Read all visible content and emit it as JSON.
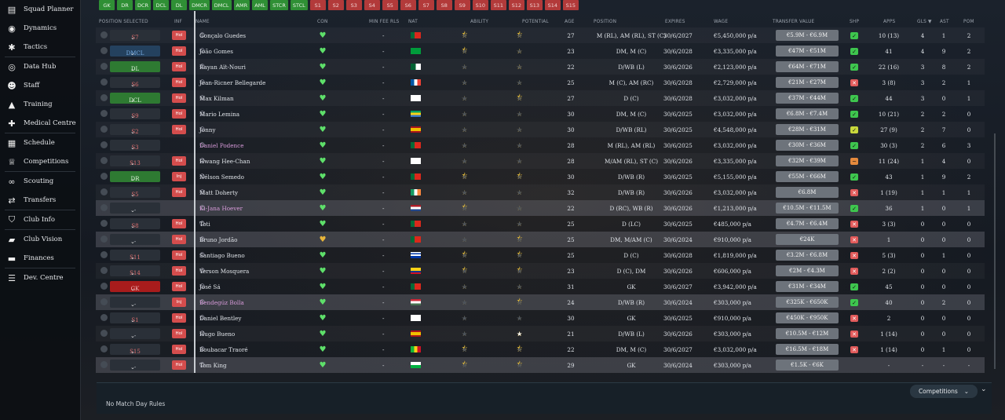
{
  "sidebar": {
    "items": [
      {
        "label": "Squad Planner",
        "icon": "clipboard-icon",
        "glyph": "▤"
      },
      {
        "label": "Dynamics",
        "icon": "dynamics-icon",
        "glyph": "◉"
      },
      {
        "label": "Tactics",
        "icon": "tactics-icon",
        "glyph": "✱"
      },
      {
        "label": "Data Hub",
        "icon": "data-hub-icon",
        "glyph": "◎"
      },
      {
        "label": "Staff",
        "icon": "staff-icon",
        "glyph": "☻"
      },
      {
        "label": "Training",
        "icon": "training-icon",
        "glyph": "▲"
      },
      {
        "label": "Medical Centre",
        "icon": "medical-icon",
        "glyph": "✚"
      },
      {
        "label": "Schedule",
        "icon": "calendar-icon",
        "glyph": "▦"
      },
      {
        "label": "Competitions",
        "icon": "trophy-icon",
        "glyph": "♕"
      },
      {
        "label": "Scouting",
        "icon": "binoculars-icon",
        "glyph": "∞"
      },
      {
        "label": "Transfers",
        "icon": "transfers-icon",
        "glyph": "⇄"
      },
      {
        "label": "Club Info",
        "icon": "club-info-icon",
        "glyph": "⛉"
      },
      {
        "label": "Club Vision",
        "icon": "club-vision-icon",
        "glyph": "▰"
      },
      {
        "label": "Finances",
        "icon": "finances-icon",
        "glyph": "▬"
      },
      {
        "label": "Dev. Centre",
        "icon": "dev-centre-icon",
        "glyph": "☰"
      }
    ]
  },
  "position_filters": [
    {
      "label": "GK",
      "state": "filled"
    },
    {
      "label": "DR",
      "state": "filled"
    },
    {
      "label": "DCR",
      "state": "filled"
    },
    {
      "label": "DCL",
      "state": "filled"
    },
    {
      "label": "DL",
      "state": "filled"
    },
    {
      "label": "DMCR",
      "state": "filled"
    },
    {
      "label": "DMCL",
      "state": "filled"
    },
    {
      "label": "AMR",
      "state": "filled"
    },
    {
      "label": "AML",
      "state": "filled"
    },
    {
      "label": "STCR",
      "state": "filled"
    },
    {
      "label": "STCL",
      "state": "filled"
    },
    {
      "label": "S1",
      "state": "sub"
    },
    {
      "label": "S2",
      "state": "sub"
    },
    {
      "label": "S3",
      "state": "sub"
    },
    {
      "label": "S4",
      "state": "sub"
    },
    {
      "label": "S5",
      "state": "sub"
    },
    {
      "label": "S6",
      "state": "sub"
    },
    {
      "label": "S7",
      "state": "sub"
    },
    {
      "label": "S8",
      "state": "sub"
    },
    {
      "label": "S9",
      "state": "sub"
    },
    {
      "label": "S10",
      "state": "sub"
    },
    {
      "label": "S11",
      "state": "sub"
    },
    {
      "label": "S12",
      "state": "sub"
    },
    {
      "label": "S13",
      "state": "sub"
    },
    {
      "label": "S14",
      "state": "sub"
    },
    {
      "label": "S15",
      "state": "sub"
    }
  ],
  "columns": {
    "position_selected": "POSITION SELECTED",
    "inf": "INF",
    "name": "NAME",
    "con": "CON",
    "min_fee": "MIN FEE RLS",
    "nat": "NAT",
    "ability": "ABILITY",
    "potential": "POTENTIAL",
    "age": "AGE",
    "position": "POSITION",
    "expires": "EXPIRES",
    "wage": "WAGE",
    "transfer_value": "TRANSFER VALUE",
    "shp": "SHP",
    "apps": "APPS",
    "gls": "GLS",
    "sort_indicator": "▼",
    "ast": "AST",
    "pom": "POM"
  },
  "players": [
    {
      "sel": "S7",
      "selc": "red",
      "inf": "Hol",
      "name": "Gonçalo Guedes",
      "pink": false,
      "con": "g",
      "minfee": "-",
      "nat": "POR",
      "ab": 3.5,
      "pot": 3.5,
      "age": "27",
      "pos": "M (RL), AM (RL), ST (C)",
      "exp": "30/6/2027",
      "wage": "€5,450,000 p/a",
      "tv": "€5.9M - €6.9M",
      "shp": "g",
      "apps": "10 (13)",
      "gls": "4",
      "ast": "1",
      "pom": "2",
      "bg": "alt"
    },
    {
      "sel": "DMCL",
      "selc": "blue",
      "inf": "Hol",
      "name": "João Gomes",
      "pink": false,
      "con": "g",
      "minfee": "-",
      "nat": "BRA",
      "ab": 3.5,
      "pot": 4,
      "age": "23",
      "pos": "DM, M (C)",
      "exp": "30/6/2028",
      "wage": "€3,335,000 p/a",
      "tv": "€47M - €51M",
      "shp": "g",
      "apps": "41",
      "gls": "4",
      "ast": "9",
      "pom": "2",
      "bg": ""
    },
    {
      "sel": "DL",
      "selc": "green",
      "inf": "Hol",
      "name": "Rayan Aït-Nouri",
      "pink": false,
      "con": "g",
      "minfee": "-",
      "nat": "ALG",
      "ab": 3,
      "pot": 4,
      "age": "22",
      "pos": "D/WB (L)",
      "exp": "30/6/2026",
      "wage": "€2,123,000 p/a",
      "tv": "€64M - €71M",
      "shp": "g",
      "apps": "22 (16)",
      "gls": "3",
      "ast": "8",
      "pom": "2",
      "bg": "alt"
    },
    {
      "sel": "S6",
      "selc": "red",
      "inf": "Hol",
      "name": "Jean-Ricner Bellegarde",
      "pink": false,
      "con": "g",
      "minfee": "-",
      "nat": "FRA",
      "ab": 3,
      "pot": 3,
      "age": "25",
      "pos": "M (C), AM (RC)",
      "exp": "30/6/2028",
      "wage": "€2,729,000 p/a",
      "tv": "€21M - €27M",
      "shp": "r",
      "apps": "3 (8)",
      "gls": "3",
      "ast": "2",
      "pom": "1",
      "bg": ""
    },
    {
      "sel": "DCL",
      "selc": "green",
      "inf": "Hol",
      "name": "Max Kilman",
      "pink": false,
      "con": "g",
      "minfee": "-",
      "nat": "ENG",
      "ab": 3,
      "pot": 3.5,
      "age": "27",
      "pos": "D (C)",
      "exp": "30/6/2028",
      "wage": "€3,032,000 p/a",
      "tv": "€37M - €44M",
      "shp": "g",
      "apps": "44",
      "gls": "3",
      "ast": "0",
      "pom": "1",
      "bg": "alt"
    },
    {
      "sel": "S9",
      "selc": "red",
      "inf": "Hol",
      "name": "Mario Lemina",
      "pink": false,
      "con": "g",
      "minfee": "-",
      "nat": "GAB",
      "ab": 3,
      "pot": 3,
      "age": "30",
      "pos": "DM, M (C)",
      "exp": "30/6/2025",
      "wage": "€3,032,000 p/a",
      "tv": "€6.8M - €7.4M",
      "shp": "g",
      "apps": "10 (21)",
      "gls": "2",
      "ast": "2",
      "pom": "0",
      "bg": ""
    },
    {
      "sel": "S2",
      "selc": "red",
      "inf": "Hol",
      "name": "Jonny",
      "pink": false,
      "con": "g",
      "minfee": "-",
      "nat": "ESP",
      "ab": 3,
      "pot": 3,
      "age": "30",
      "pos": "D/WB (RL)",
      "exp": "30/6/2025",
      "wage": "€4,548,000 p/a",
      "tv": "€28M - €31M",
      "shp": "y",
      "apps": "27 (9)",
      "gls": "2",
      "ast": "7",
      "pom": "0",
      "bg": "alt"
    },
    {
      "sel": "S3",
      "selc": "red",
      "inf": "",
      "name": "Daniel Podence",
      "pink": true,
      "con": "g",
      "minfee": "-",
      "nat": "POR",
      "ab": 3,
      "pot": 3,
      "age": "28",
      "pos": "M (RL), AM (RL)",
      "exp": "30/6/2025",
      "wage": "€3,032,000 p/a",
      "tv": "€30M - €36M",
      "shp": "g",
      "apps": "30 (3)",
      "gls": "2",
      "ast": "6",
      "pom": "3",
      "bg": ""
    },
    {
      "sel": "S13",
      "selc": "red",
      "inf": "Hol",
      "name": "Hwang Hee-Chan",
      "pink": false,
      "con": "g",
      "minfee": "-",
      "nat": "KOR",
      "ab": 3,
      "pot": 3,
      "age": "28",
      "pos": "M/AM (RL), ST (C)",
      "exp": "30/6/2026",
      "wage": "€3,335,000 p/a",
      "tv": "€32M - €39M",
      "shp": "o",
      "apps": "11 (24)",
      "gls": "1",
      "ast": "4",
      "pom": "0",
      "bg": "alt"
    },
    {
      "sel": "DR",
      "selc": "green",
      "inf": "Inj",
      "name": "Nélson Semedo",
      "pink": false,
      "con": "g",
      "minfee": "-",
      "nat": "POR",
      "ab": 3.5,
      "pot": 3.5,
      "age": "30",
      "pos": "D/WB (R)",
      "exp": "30/6/2025",
      "wage": "€5,155,000 p/a",
      "tv": "€55M - €66M",
      "shp": "g",
      "apps": "43",
      "gls": "1",
      "ast": "9",
      "pom": "2",
      "bg": ""
    },
    {
      "sel": "S5",
      "selc": "red",
      "inf": "Hol",
      "name": "Matt Doherty",
      "pink": false,
      "con": "g",
      "minfee": "-",
      "nat": "IRL",
      "ab": 3,
      "pot": 3,
      "age": "32",
      "pos": "D/WB (R)",
      "exp": "30/6/2026",
      "wage": "€3,032,000 p/a",
      "tv": "€6.8M",
      "shp": "r",
      "apps": "1 (19)",
      "gls": "1",
      "ast": "1",
      "pom": "1",
      "bg": "alt"
    },
    {
      "sel": "-",
      "selc": "none",
      "inf": "",
      "name": "Ki-Jana Hoever",
      "pink": true,
      "con": "g",
      "minfee": "-",
      "nat": "NED",
      "ab": 2.5,
      "pot": 3,
      "age": "22",
      "pos": "D (RC), WB (R)",
      "exp": "30/6/2026",
      "wage": "€1,213,000 p/a",
      "tv": "€10.5M - €11.5M",
      "shp": "g",
      "apps": "36",
      "gls": "1",
      "ast": "0",
      "pom": "1",
      "bg": "loan"
    },
    {
      "sel": "S8",
      "selc": "red",
      "inf": "Hol",
      "name": "Toti",
      "pink": false,
      "con": "g",
      "minfee": "-",
      "nat": "POR",
      "ab": 3,
      "pot": 3,
      "age": "25",
      "pos": "D (LC)",
      "exp": "30/6/2025",
      "wage": "€485,000 p/a",
      "tv": "€4.7M - €6.4M",
      "shp": "r",
      "apps": "3 (3)",
      "gls": "0",
      "ast": "0",
      "pom": "0",
      "bg": ""
    },
    {
      "sel": "-",
      "selc": "none",
      "inf": "Hol",
      "name": "Bruno Jordão",
      "pink": false,
      "con": "y",
      "minfee": "-",
      "nat": "POR",
      "ab": 2,
      "pot": 2.5,
      "age": "25",
      "pos": "DM, M/AM (C)",
      "exp": "30/6/2024",
      "wage": "€910,000 p/a",
      "tv": "€24K",
      "shp": "r",
      "apps": "1",
      "gls": "0",
      "ast": "0",
      "pom": "0",
      "bg": "loan"
    },
    {
      "sel": "S11",
      "selc": "red",
      "inf": "Hol",
      "name": "Santiago Bueno",
      "pink": false,
      "con": "g",
      "minfee": "-",
      "nat": "URU",
      "ab": 2.5,
      "pot": 2.5,
      "age": "25",
      "pos": "D (C)",
      "exp": "30/6/2028",
      "wage": "€1,819,000 p/a",
      "tv": "€3.2M - €6.8M",
      "shp": "r",
      "apps": "5 (3)",
      "gls": "0",
      "ast": "1",
      "pom": "0",
      "bg": ""
    },
    {
      "sel": "S14",
      "selc": "red",
      "inf": "Hol",
      "name": "Yerson Mosquera",
      "pink": false,
      "con": "g",
      "minfee": "-",
      "nat": "COL",
      "ab": 2.5,
      "pot": 2.5,
      "age": "23",
      "pos": "D (C), DM",
      "exp": "30/6/2026",
      "wage": "€606,000 p/a",
      "tv": "€2M - €4.3M",
      "shp": "r",
      "apps": "2 (2)",
      "gls": "0",
      "ast": "0",
      "pom": "0",
      "bg": "alt"
    },
    {
      "sel": "GK",
      "selc": "gkred",
      "inf": "Hol",
      "name": "José Sá",
      "pink": false,
      "con": "g",
      "minfee": "-",
      "nat": "POR",
      "ab": 3,
      "pot": 3,
      "age": "31",
      "pos": "GK",
      "exp": "30/6/2027",
      "wage": "€3,942,000 p/a",
      "tv": "€31M - €34M",
      "shp": "g",
      "apps": "45",
      "gls": "0",
      "ast": "0",
      "pom": "0",
      "bg": ""
    },
    {
      "sel": "-",
      "selc": "none",
      "inf": "Inj",
      "name": "Bendegúz Bolla",
      "pink": true,
      "con": "g",
      "minfee": "-",
      "nat": "HUN",
      "ab": 2,
      "pot": 2.5,
      "age": "24",
      "pos": "D/WB (R)",
      "exp": "30/6/2024",
      "wage": "€303,000 p/a",
      "tv": "€325K - €650K",
      "shp": "g",
      "apps": "40",
      "gls": "0",
      "ast": "2",
      "pom": "0",
      "bg": "loan"
    },
    {
      "sel": "S1",
      "selc": "red",
      "inf": "Hol",
      "name": "Daniel Bentley",
      "pink": false,
      "con": "g",
      "minfee": "-",
      "nat": "ENG",
      "ab": 2,
      "pot": 2,
      "age": "30",
      "pos": "GK",
      "exp": "30/6/2025",
      "wage": "€910,000 p/a",
      "tv": "€450K - €950K",
      "shp": "r",
      "apps": "2",
      "gls": "0",
      "ast": "0",
      "pom": "0",
      "bg": ""
    },
    {
      "sel": "-",
      "selc": "none",
      "inf": "Hol",
      "name": "Hugo Bueno",
      "pink": false,
      "con": "g",
      "minfee": "-",
      "nat": "ESP",
      "ab": 2,
      "pot": 4,
      "potwhite": true,
      "age": "21",
      "pos": "D/WB (L)",
      "exp": "30/6/2026",
      "wage": "€303,000 p/a",
      "tv": "€10.5M - €12M",
      "shp": "r",
      "apps": "1 (14)",
      "gls": "0",
      "ast": "0",
      "pom": "0",
      "bg": "alt"
    },
    {
      "sel": "S15",
      "selc": "red",
      "inf": "Hol",
      "name": "Boubacar Traoré",
      "pink": false,
      "con": "g",
      "minfee": "-",
      "nat": "MLI",
      "ab": 2.5,
      "pot": 3.5,
      "age": "22",
      "pos": "DM, M (C)",
      "exp": "30/6/2027",
      "wage": "€3,032,000 p/a",
      "tv": "€16.5M - €18M",
      "shp": "r",
      "apps": "1 (14)",
      "gls": "0",
      "ast": "1",
      "pom": "0",
      "bg": ""
    },
    {
      "sel": "-",
      "selc": "none",
      "inf": "Hol",
      "name": "Tom King",
      "pink": false,
      "con": "g",
      "minfee": "-",
      "nat": "WAL",
      "ab": 1.5,
      "pot": 1.5,
      "age": "29",
      "pos": "GK",
      "exp": "30/6/2024",
      "wage": "€303,000 p/a",
      "tv": "€1.5K - €6K",
      "shp": "none",
      "apps": "-",
      "gls": "-",
      "ast": "-",
      "pom": "-",
      "bg": "loan"
    }
  ],
  "footer": {
    "rules_text": "No Match Day Rules",
    "competitions_label": "Competitions",
    "competitions_chevron": "⌄",
    "expand_chevron": "⌄"
  },
  "colors": {
    "accent_green": "#2f8f35",
    "sub_red": "#b23a3a",
    "star_gold": "#f0c43a",
    "happy_green": "#5ee06a"
  }
}
